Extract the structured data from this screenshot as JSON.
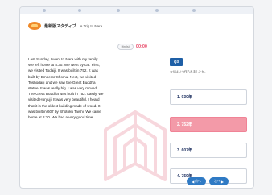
{
  "app": {
    "title": "最新版スタディブ",
    "subtitle": "A Trip to Nara"
  },
  "timer": {
    "chip_label": "Hint(s)",
    "time": "00:00"
  },
  "passage": {
    "text": "Last Sunday, I went to Nara with my family. We left home at 8:30. We went by car. First, we visited Todaiji. It was built in 752. It was built by Emperor Shomu. Next, we visited Toshodaiji and we saw the Great Buddha statue. It was really big. I was very moved. The Great Buddha was built in 752. Lastly, we visited Horyuji. It was very beautiful. I heard that it is the oldest building made of wood. It was built in 607 by Shotoku Taishi. We came home at 6:30. We had a very good time."
  },
  "question": {
    "tag": "Q3",
    "prompt": "大仏はいつ作られましたか。"
  },
  "choices": [
    {
      "label": "1. 930年",
      "selected": false
    },
    {
      "label": "2. 752年",
      "selected": true
    },
    {
      "label": "3. 607年",
      "selected": false
    },
    {
      "label": "4. 759年",
      "selected": false
    }
  ],
  "nav": {
    "prev_label": "前へ",
    "next_label": "次へ"
  },
  "colors": {
    "accent": "#1e5fa6",
    "selected": "#f39aa8",
    "timer": "#e84f6d",
    "nav": "#2f7ac4"
  }
}
